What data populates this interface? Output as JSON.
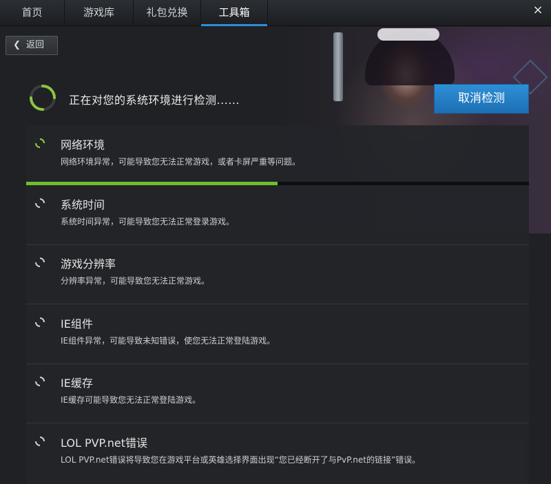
{
  "nav": {
    "tabs": [
      {
        "label": "首页"
      },
      {
        "label": "游戏库"
      },
      {
        "label": "礼包兑换"
      },
      {
        "label": "工具箱"
      }
    ],
    "active_tab": "工具箱",
    "close_symbol": "×"
  },
  "back": {
    "label": "返回",
    "icon": "chevron-left-icon"
  },
  "status": {
    "text": "正在对您的系统环境进行检测......"
  },
  "cancel": {
    "label": "取消检测"
  },
  "colors": {
    "accent_blue": "#2c8fd8",
    "progress_green": "#6fbe2c",
    "spinner_green": "#8dc63f"
  },
  "progress": {
    "fraction": 0.5
  },
  "checks": [
    {
      "title": "网络环境",
      "desc": "网络环境异常，可能导致您无法正常游戏，或者卡屏严重等问题。",
      "state": "running"
    },
    {
      "title": "系统时间",
      "desc": "系统时间异常，可能导致您无法正常登录游戏。",
      "state": "pending"
    },
    {
      "title": "游戏分辨率",
      "desc": "分辨率异常，可能导致您无法正常游戏。",
      "state": "pending"
    },
    {
      "title": "IE组件",
      "desc": "IE组件异常，可能导致未知错误，使您无法正常登陆游戏。",
      "state": "pending"
    },
    {
      "title": "IE缓存",
      "desc": "IE缓存可能导致您无法正常登陆游戏。",
      "state": "pending"
    },
    {
      "title": "LOL PVP.net错误",
      "desc": "LOL PVP.net错误将导致您在游戏平台或英雄选择界面出现“您已经断开了与PvP.net的链接”错误。",
      "state": "pending"
    }
  ]
}
